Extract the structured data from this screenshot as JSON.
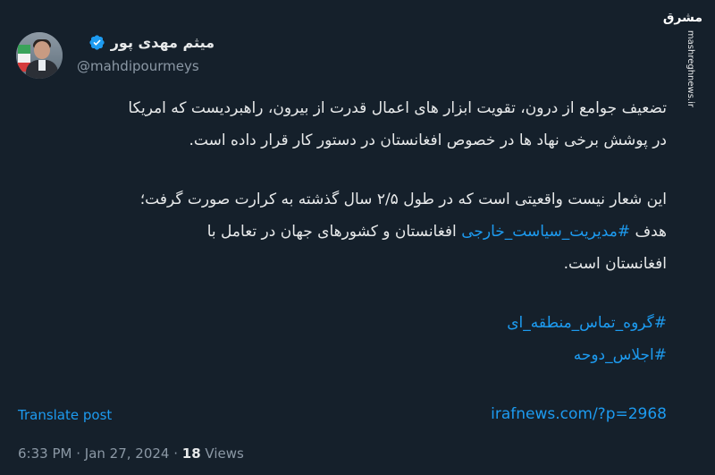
{
  "author": {
    "name": "میثم مهدی پور",
    "handle": "@mahdipourmeys"
  },
  "watermark": {
    "logo": "مشرق",
    "text": "mashreghnews.ir"
  },
  "tweet": {
    "line1": "تضعیف جوامع از درون، تقویت ابزار های اعمال قدرت از بیرون، راهبردیست که امریکا",
    "line2": "در پوشش برخی نهاد ها  در خصوص افغانستان در دستور کار قرار داده است.",
    "line3": "این شعار نیست واقعیتی است که در طول ۲/۵ سال گذشته به کرارت صورت گرفت؛",
    "line4_prefix": "هدف ",
    "line4_hashtag": "#مدیریت_سیاست_خارجی",
    "line4_suffix": " افغانستان و کشورهای جهان در تعامل با",
    "line5": "افغانستان است.",
    "hashtag1": "#گروه_تماس_منطقه_ای",
    "hashtag2": "#اجلاس_دوحه",
    "url": "irafnews.com/?p=2968"
  },
  "translate_label": "Translate post",
  "meta": {
    "time": "6:33 PM",
    "sep1": " · ",
    "date": "Jan 27, 2024",
    "sep2": " · ",
    "views_count": "18",
    "views_label": " Views"
  },
  "colors": {
    "background": "#15202b",
    "text": "#e7e9ea",
    "secondary": "#8b98a5",
    "link": "#1d9bf0"
  },
  "icons": [
    "verified-badge-icon"
  ]
}
